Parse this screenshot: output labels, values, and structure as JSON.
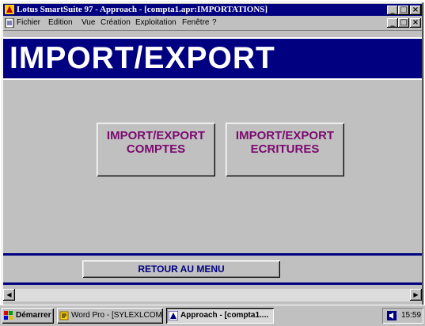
{
  "window": {
    "title": "Lotus SmartSuite 97   - Approach - [compta1.apr:IMPORTATIONS]",
    "controls": {
      "minimize": "_",
      "maximize": "□",
      "close": "×"
    }
  },
  "menu": {
    "items": [
      "Fichier",
      "Edition",
      "Vue",
      "Création",
      "Exploitation",
      "Fenêtre",
      "?"
    ]
  },
  "form": {
    "banner_title": "IMPORT/EXPORT",
    "buttons": [
      {
        "line1": "IMPORT/EXPORT",
        "line2": "COMPTES"
      },
      {
        "line1": "IMPORT/EXPORT",
        "line2": "ECRITURES"
      }
    ],
    "return_label": "RETOUR AU MENU"
  },
  "scrollbar": {
    "left_arrow": "◀",
    "right_arrow": "▶"
  },
  "taskbar": {
    "start_label": "Démarrer",
    "tasks": [
      "Word Pro - [SYLEXLCOM...",
      "Approach - [compta1...."
    ],
    "active_task": 1,
    "clock": "15:59"
  },
  "colors": {
    "title_bar": "#000080",
    "banner": "#000080",
    "button_text": "#7a0a6e"
  },
  "icons": [
    "lotus-app-icon",
    "document-icon",
    "windows-logo-icon",
    "word-pro-icon",
    "approach-icon",
    "speaker-icon"
  ]
}
